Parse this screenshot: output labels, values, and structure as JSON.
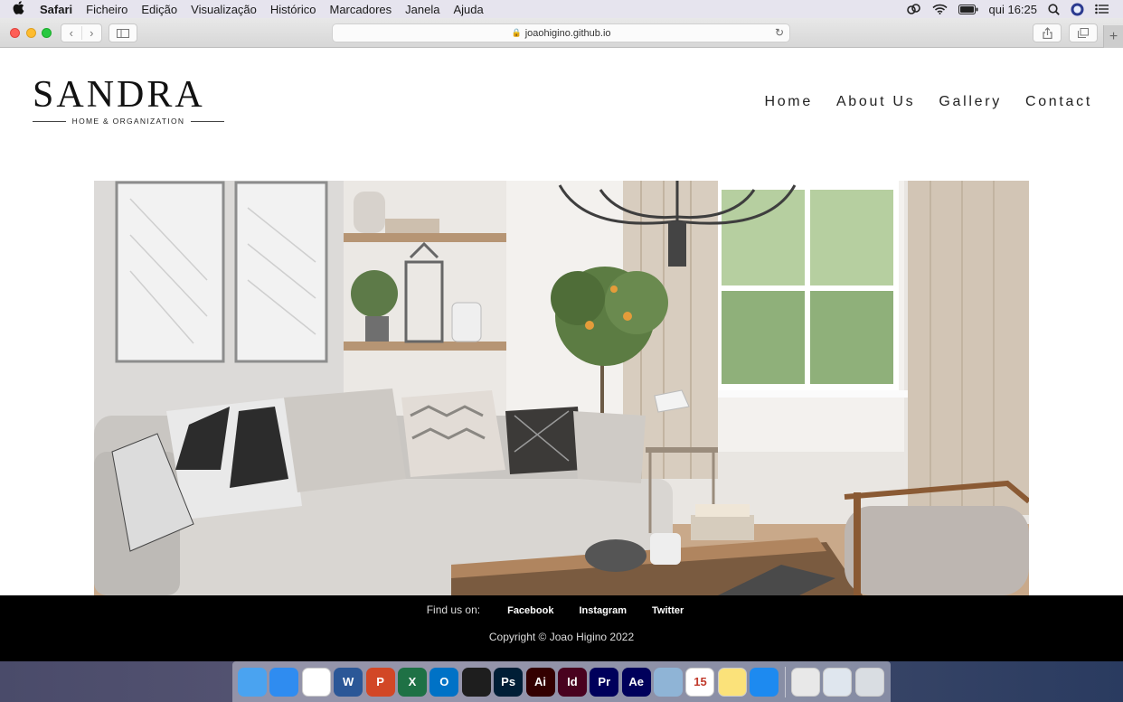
{
  "menubar": {
    "app_name": "Safari",
    "items": [
      "Ficheiro",
      "Edição",
      "Visualização",
      "Histórico",
      "Marcadores",
      "Janela",
      "Ajuda"
    ],
    "clock": "qui 16:25"
  },
  "browser": {
    "url": "joaohigino.github.io"
  },
  "site": {
    "logo_main": "SANDRA",
    "logo_sub": "HOME & ORGANIZATION",
    "nav": [
      "Home",
      "About Us",
      "Gallery",
      "Contact"
    ],
    "footer": {
      "find_label": "Find us on:",
      "links": [
        "Facebook",
        "Instagram",
        "Twitter"
      ],
      "copyright": "Copyright © Joao Higino 2022"
    }
  },
  "dock": {
    "apps": [
      {
        "name": "finder-icon",
        "label": "",
        "color": "#4aa3f0"
      },
      {
        "name": "safari-icon",
        "label": "",
        "color": "#2f8cf0"
      },
      {
        "name": "chrome-icon",
        "label": "",
        "color": "#ffffff"
      },
      {
        "name": "word-icon",
        "label": "W",
        "color": "#2b5797"
      },
      {
        "name": "powerpoint-icon",
        "label": "P",
        "color": "#d24726"
      },
      {
        "name": "excel-icon",
        "label": "X",
        "color": "#1e7145"
      },
      {
        "name": "outlook-icon",
        "label": "O",
        "color": "#0072c6"
      },
      {
        "name": "figma-icon",
        "label": "",
        "color": "#1e1e1e"
      },
      {
        "name": "photoshop-icon",
        "label": "Ps",
        "color": "#001e36"
      },
      {
        "name": "illustrator-icon",
        "label": "Ai",
        "color": "#330000"
      },
      {
        "name": "indesign-icon",
        "label": "Id",
        "color": "#49021f"
      },
      {
        "name": "premiere-icon",
        "label": "Pr",
        "color": "#00005b"
      },
      {
        "name": "aftereffects-icon",
        "label": "Ae",
        "color": "#00005b"
      },
      {
        "name": "preview-icon",
        "label": "",
        "color": "#8fb4d6"
      },
      {
        "name": "calendar-icon",
        "label": "15",
        "color": "#ffffff"
      },
      {
        "name": "notes-icon",
        "label": "",
        "color": "#fbe27a"
      },
      {
        "name": "appstore-icon",
        "label": "",
        "color": "#1d8af0"
      },
      {
        "name": "sep",
        "label": "",
        "color": ""
      },
      {
        "name": "microsoft-office-icon",
        "label": "",
        "color": "#e8e8e8"
      },
      {
        "name": "downloads-stack-icon",
        "label": "",
        "color": "#dfe6ee"
      },
      {
        "name": "trash-icon",
        "label": "",
        "color": "#d9dde2"
      }
    ]
  }
}
